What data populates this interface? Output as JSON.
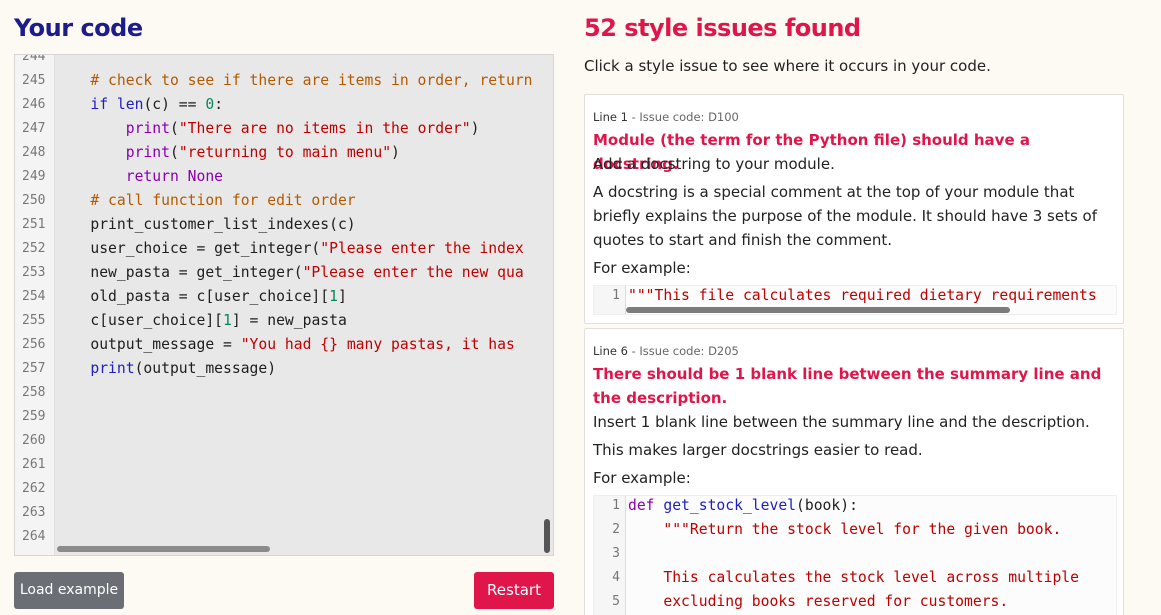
{
  "left": {
    "heading": "Your code",
    "editor": {
      "line_numbers": [
        "244",
        "245",
        "246",
        "247",
        "248",
        "249",
        "250",
        "251",
        "252",
        "253",
        "254",
        "255",
        "256",
        "257",
        "258",
        "259",
        "260",
        "261",
        "262",
        "263",
        "264"
      ],
      "lines": [
        [
          {
            "c": "tk-st",
            "t": "    \"\"\""
          }
        ],
        [
          {
            "c": "tk-cm",
            "t": "    # check to see if there are items in order, return"
          }
        ],
        [
          {
            "c": "tk-kw",
            "t": "    if "
          },
          {
            "c": "tk-kw",
            "t": "len"
          },
          {
            "c": "",
            "t": "(c) == "
          },
          {
            "c": "tk-nm",
            "t": "0"
          },
          {
            "c": "",
            "t": ":"
          }
        ],
        [
          {
            "c": "tk-kw2",
            "t": "        print"
          },
          {
            "c": "",
            "t": "("
          },
          {
            "c": "tk-st",
            "t": "\"There are no items in the order\""
          },
          {
            "c": "",
            "t": ")"
          }
        ],
        [
          {
            "c": "tk-kw2",
            "t": "        print"
          },
          {
            "c": "",
            "t": "("
          },
          {
            "c": "tk-st",
            "t": "\"returning to main menu\""
          },
          {
            "c": "",
            "t": ")"
          }
        ],
        [
          {
            "c": "tk-kw2",
            "t": "        return None"
          }
        ],
        [
          {
            "c": "tk-cm",
            "t": "    # call function for edit order"
          }
        ],
        [
          {
            "c": "",
            "t": "    print_customer_list_indexes(c)"
          }
        ],
        [
          {
            "c": "",
            "t": "    user_choice = get_integer("
          },
          {
            "c": "tk-st",
            "t": "\"Please enter the index"
          }
        ],
        [
          {
            "c": "",
            "t": "    new_pasta = get_integer("
          },
          {
            "c": "tk-st",
            "t": "\"Please enter the new qua"
          }
        ],
        [
          {
            "c": "",
            "t": "    old_pasta = c[user_choice]["
          },
          {
            "c": "tk-nm",
            "t": "1"
          },
          {
            "c": "",
            "t": "]"
          }
        ],
        [
          {
            "c": "",
            "t": "    c[user_choice]["
          },
          {
            "c": "tk-nm",
            "t": "1"
          },
          {
            "c": "",
            "t": "] = new_pasta"
          }
        ],
        [
          {
            "c": "",
            "t": "    output_message = "
          },
          {
            "c": "tk-st",
            "t": "\"You had {} many pastas, it has"
          }
        ],
        [
          {
            "c": "tk-kw",
            "t": "    print"
          },
          {
            "c": "",
            "t": "(output_message)"
          }
        ],
        [],
        [],
        [],
        [],
        [],
        [],
        []
      ]
    },
    "load_button": "Load example",
    "restart_button": "Restart"
  },
  "right": {
    "heading": "52 style issues found",
    "subtitle": "Click a style issue to see where it occurs in your code.",
    "issues": [
      {
        "line_label": "Line 1",
        "code_label": " - Issue code: D100",
        "title": "Module (the term for the Python file) should have a docstring.",
        "fix": "Add a docstring to your module.",
        "explanation": "A docstring is a special comment at the top of your module that briefly explains the purpose of the module. It should have 3 sets of quotes to start and finish the comment.",
        "example_label": "For example:",
        "example_line_numbers": [
          "1"
        ],
        "example_lines": [
          [
            {
              "c": "tk-st",
              "t": "\"\"\"This file calculates required dietary requirements"
            }
          ]
        ]
      },
      {
        "line_label": "Line 6",
        "code_label": " - Issue code: D205",
        "title": "There should be 1 blank line between the summary line and the description.",
        "fix": "Insert 1 blank line between the summary line and the description.",
        "explanation": "This makes larger docstrings easier to read.",
        "example_label": "For example:",
        "example_line_numbers": [
          "1",
          "2",
          "3",
          "4",
          "5"
        ],
        "example_lines": [
          [
            {
              "c": "tk-kw2",
              "t": "def "
            },
            {
              "c": "tk-kw",
              "t": "get_stock_level"
            },
            {
              "c": "",
              "t": "(book):"
            }
          ],
          [
            {
              "c": "tk-st",
              "t": "    \"\"\"Return the stock level for the given book."
            }
          ],
          [],
          [
            {
              "c": "tk-st",
              "t": "    This calculates the stock level across multiple"
            }
          ],
          [
            {
              "c": "tk-st",
              "t": "    excluding books reserved for customers."
            }
          ]
        ]
      }
    ]
  }
}
